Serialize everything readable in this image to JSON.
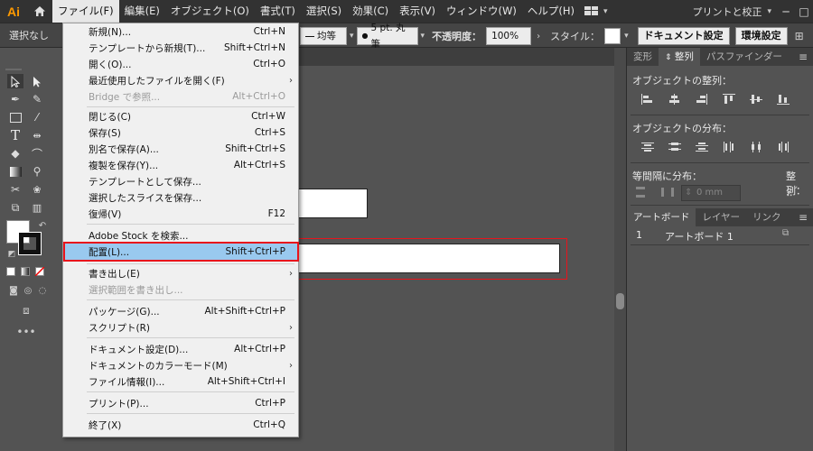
{
  "app": {
    "logo": "Ai"
  },
  "menubar": {
    "items": [
      "ファイル(F)",
      "編集(E)",
      "オブジェクト(O)",
      "書式(T)",
      "選択(S)",
      "効果(C)",
      "表示(V)",
      "ウィンドウ(W)",
      "ヘルプ(H)"
    ],
    "workspace": "プリントと校正",
    "minimize": "─",
    "maximize": "□"
  },
  "control": {
    "selection": "選択なし",
    "stroke_profile": "均等",
    "brush": "5 pt. 丸筆",
    "opacity_label": "不透明度：",
    "opacity_value": "100%",
    "style_label": "スタイル：",
    "doc_settings": "ドキュメント設定",
    "prefs": "環境設定"
  },
  "file_menu": [
    {
      "label": "新規(N)...",
      "shortcut": "Ctrl+N"
    },
    {
      "label": "テンプレートから新規(T)...",
      "shortcut": "Shift+Ctrl+N"
    },
    {
      "label": "開く(O)...",
      "shortcut": "Ctrl+O"
    },
    {
      "label": "最近使用したファイルを開く(F)",
      "shortcut": ""
    },
    {
      "label": "Bridge で参照...",
      "shortcut": "Alt+Ctrl+O"
    },
    {
      "label": "閉じる(C)",
      "shortcut": "Ctrl+W"
    },
    {
      "label": "保存(S)",
      "shortcut": "Ctrl+S"
    },
    {
      "label": "別名で保存(A)...",
      "shortcut": "Shift+Ctrl+S"
    },
    {
      "label": "複製を保存(Y)...",
      "shortcut": "Alt+Ctrl+S"
    },
    {
      "label": "テンプレートとして保存...",
      "shortcut": ""
    },
    {
      "label": "選択したスライスを保存...",
      "shortcut": ""
    },
    {
      "label": "復帰(V)",
      "shortcut": "F12"
    },
    {
      "label": "Adobe Stock を検索...",
      "shortcut": ""
    },
    {
      "label": "配置(L)...",
      "shortcut": "Shift+Ctrl+P"
    },
    {
      "label": "書き出し(E)",
      "shortcut": ""
    },
    {
      "label": "選択範囲を書き出し...",
      "shortcut": ""
    },
    {
      "label": "パッケージ(G)...",
      "shortcut": "Alt+Shift+Ctrl+P"
    },
    {
      "label": "スクリプト(R)",
      "shortcut": ""
    },
    {
      "label": "ドキュメント設定(D)...",
      "shortcut": "Alt+Ctrl+P"
    },
    {
      "label": "ドキュメントのカラーモード(M)",
      "shortcut": ""
    },
    {
      "label": "ファイル情報(I)...",
      "shortcut": "Alt+Shift+Ctrl+I"
    },
    {
      "label": "プリント(P)...",
      "shortcut": "Ctrl+P"
    },
    {
      "label": "終了(X)",
      "shortcut": "Ctrl+Q"
    }
  ],
  "align_panel": {
    "tabs": [
      "変形",
      "整列",
      "パスファインダー"
    ],
    "align_objects": "オブジェクトの整列：",
    "distribute_objects": "オブジェクトの分布：",
    "distribute_spacing": "等間隔に分布：",
    "align_to": "整列：",
    "spacing_value": "0 mm"
  },
  "artboard_panel": {
    "tabs": [
      "アートボード",
      "レイヤー",
      "リンク"
    ],
    "row_number": "1",
    "row_name": "アートボード 1"
  },
  "colors": {
    "accent_logo": "#FF9A00",
    "highlight": "#99C9EF",
    "annotation": "#E8141C"
  }
}
